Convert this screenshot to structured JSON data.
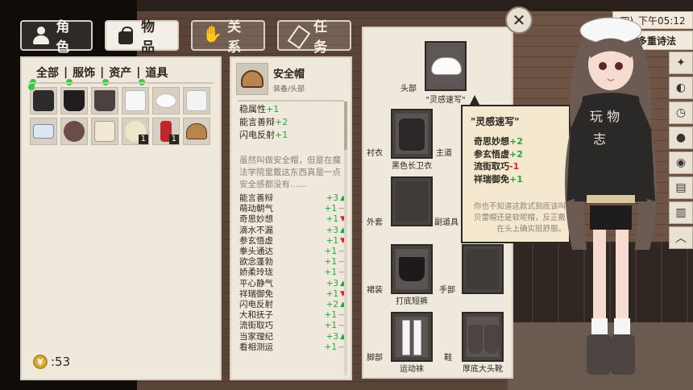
{
  "tabs": [
    {
      "label": "角色",
      "icon": "person-icon"
    },
    {
      "label": "物品",
      "icon": "bag-icon"
    },
    {
      "label": "关系",
      "icon": "handshake-icon"
    },
    {
      "label": "任务",
      "icon": "quill-icon"
    }
  ],
  "categories": [
    "全部",
    "服饰",
    "资产",
    "道具"
  ],
  "category_separator": "|",
  "inventory": [
    {
      "name": "black-hoodie",
      "qty": ""
    },
    {
      "name": "black-shorts",
      "qty": ""
    },
    {
      "name": "boots",
      "qty": ""
    },
    {
      "name": "white-socks",
      "qty": ""
    },
    {
      "name": "white-beret",
      "qty": ""
    },
    {
      "name": "white-sweater",
      "qty": ""
    },
    {
      "name": "id-card",
      "qty": ""
    },
    {
      "name": "badge",
      "qty": ""
    },
    {
      "name": "paper-note",
      "qty": ""
    },
    {
      "name": "flowers",
      "qty": "1"
    },
    {
      "name": "soda-can",
      "qty": "1"
    },
    {
      "name": "safety-helmet",
      "qty": ""
    }
  ],
  "money": {
    "symbol": "¥",
    "value": ":53"
  },
  "detail": {
    "name": "安全帽",
    "subtitle": "装备/头部",
    "stats": [
      {
        "label": "稳属性",
        "value": "+1"
      },
      {
        "label": "能言善辩",
        "value": "+2"
      },
      {
        "label": "闪电反射",
        "value": "+1"
      }
    ],
    "description": "虽然叫做安全帽，但是在魔法学院里戴这东西真是一点安全感都没有……",
    "skills": [
      {
        "name": "能言善辩",
        "value": "+3",
        "trend": "up"
      },
      {
        "name": "萌动朝气",
        "value": "+1",
        "trend": "flat"
      },
      {
        "name": "奇思妙想",
        "value": "+1",
        "trend": "down"
      },
      {
        "name": "滴水不漏",
        "value": "+3",
        "trend": "up"
      },
      {
        "name": "参玄悟虚",
        "value": "+1",
        "trend": "down"
      },
      {
        "name": "拳头通达",
        "value": "+1",
        "trend": "flat"
      },
      {
        "name": "欲念蓬勃",
        "value": "+1",
        "trend": "flat"
      },
      {
        "name": "娇柔玲珑",
        "value": "+1",
        "trend": "flat"
      },
      {
        "name": "平心静气",
        "value": "+3",
        "trend": "up"
      },
      {
        "name": "祥瑞御免",
        "value": "+1",
        "trend": "down"
      },
      {
        "name": "闪电反射",
        "value": "+2",
        "trend": "up"
      },
      {
        "name": "大和抚子",
        "value": "+1",
        "trend": "flat"
      },
      {
        "name": "流街取巧",
        "value": "+1",
        "trend": "flat"
      },
      {
        "name": "当家理纪",
        "value": "+3",
        "trend": "up"
      },
      {
        "name": "看相测运",
        "value": "+1",
        "trend": "flat"
      }
    ]
  },
  "equipment": {
    "head": {
      "label": "头部",
      "item": "\"灵感速写\""
    },
    "shirt": {
      "label": "衬衣",
      "item": "黑色长卫衣"
    },
    "main": {
      "label": "主道"
    },
    "outer": {
      "label": "外套"
    },
    "sub": {
      "label": "副道具"
    },
    "pants": {
      "label": "裙装",
      "item": "打底短裤"
    },
    "hand": {
      "label": "手部"
    },
    "legs": {
      "label": "脚部",
      "item": "运动袜"
    },
    "shoes": {
      "label": "鞋",
      "item": "厚底大头靴"
    }
  },
  "tooltip": {
    "title": "\"灵感速写\"",
    "stats": [
      {
        "label": "奇思妙想",
        "value": "+2",
        "sign": "plus"
      },
      {
        "label": "参玄悟虚",
        "value": "+2",
        "sign": "plus"
      },
      {
        "label": "流街取巧",
        "value": "-1",
        "sign": "minus"
      },
      {
        "label": "祥瑞御免",
        "value": "+1",
        "sign": "plus"
      }
    ],
    "description": "你也不知道这款式到底该叫贝雷帽还是软呢帽，反正戴在头上确实挺舒服。"
  },
  "hud": {
    "time_prefix": "四)",
    "time": "下午05:12",
    "status": "多重诗法"
  },
  "colors": {
    "plus": "#27a53b",
    "minus": "#dd2222",
    "panel": "#efe9dd",
    "dark_tab": "#2e2a27"
  }
}
